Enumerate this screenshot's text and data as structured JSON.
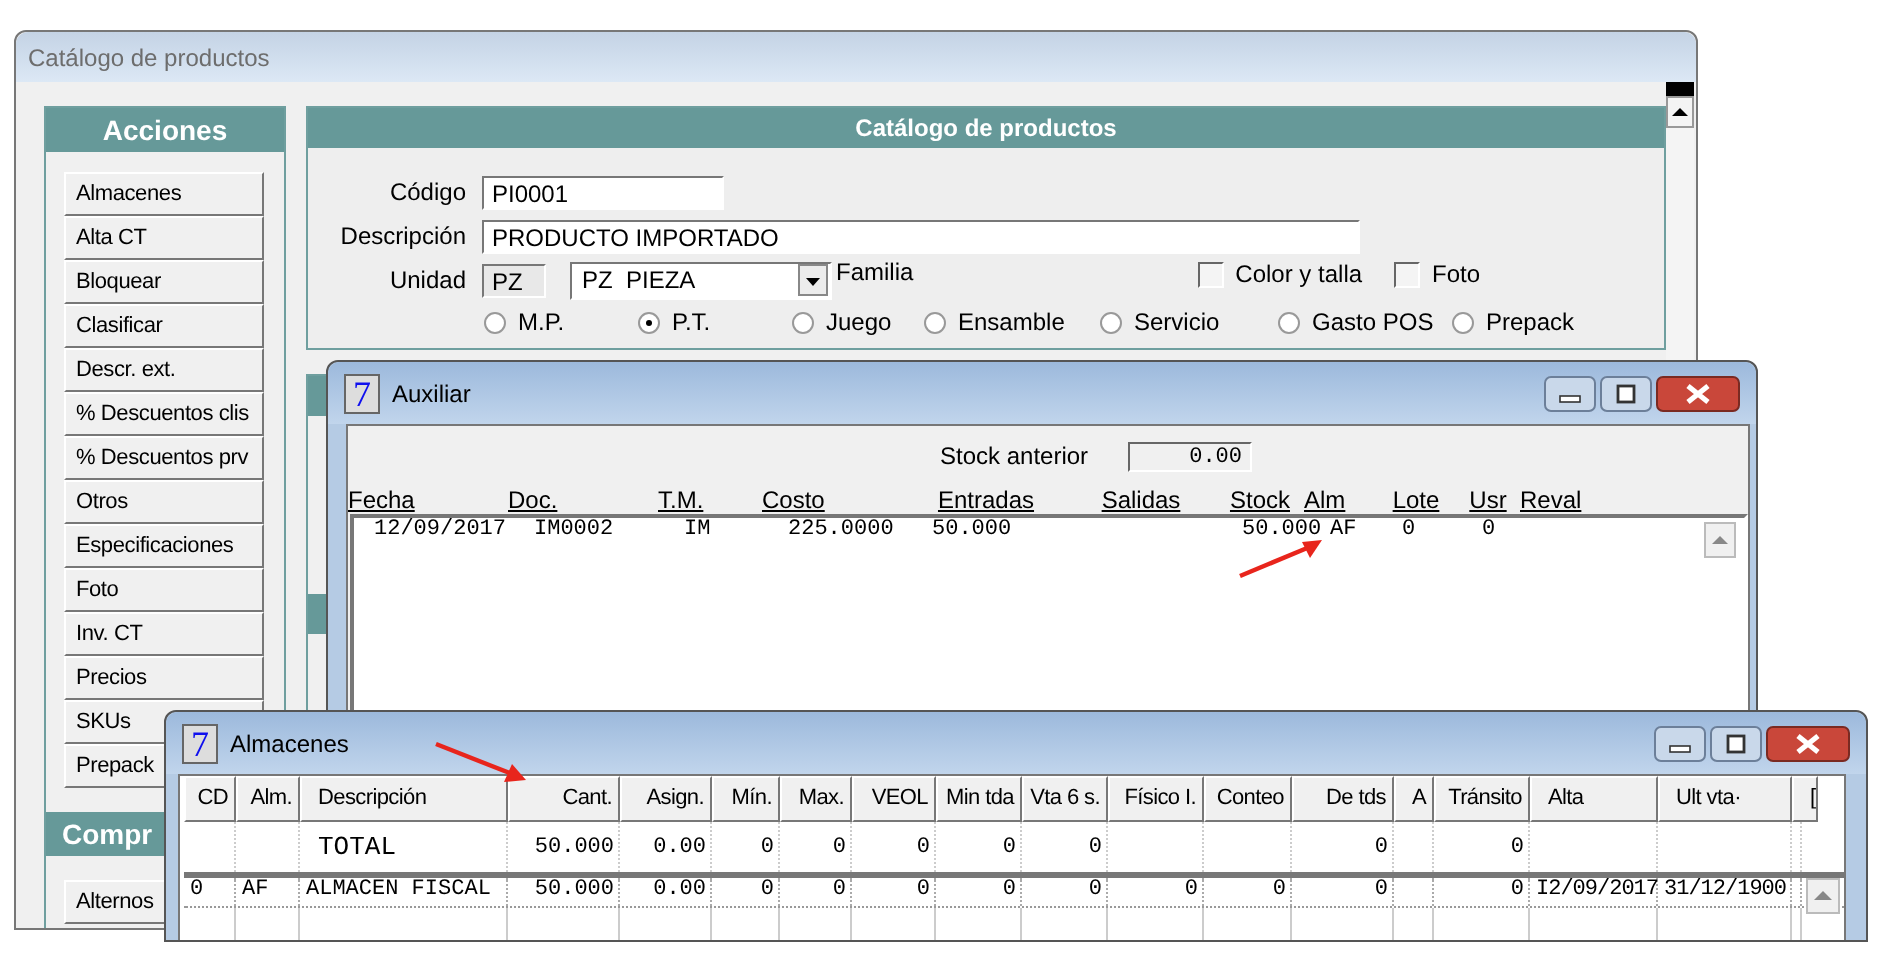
{
  "main_window": {
    "title": "Catálogo de productos"
  },
  "sidebar": {
    "title": "Acciones",
    "items": [
      {
        "label": "Almacenes"
      },
      {
        "label": "Alta CT"
      },
      {
        "label": "Bloquear"
      },
      {
        "label": "Clasificar"
      },
      {
        "label": "Descr. ext."
      },
      {
        "label": "% Descuentos clis"
      },
      {
        "label": "% Descuentos prv"
      },
      {
        "label": "Otros"
      },
      {
        "label": "Especificaciones"
      },
      {
        "label": "Foto"
      },
      {
        "label": "Inv. CT"
      },
      {
        "label": "Precios"
      },
      {
        "label": "SKUs"
      },
      {
        "label": "Prepack"
      }
    ],
    "section_2_title": "Compr",
    "section_2_items": [
      {
        "label": "Alternos"
      }
    ]
  },
  "product_panel": {
    "title": "Catálogo de productos",
    "codigo_label": "Código",
    "codigo": "PI0001",
    "descripcion_label": "Descripción",
    "descripcion": "PRODUCTO IMPORTADO",
    "unidad_label": "Unidad",
    "unidad_code": "PZ",
    "unidad": "PZ  PIEZA",
    "familia_label": "Familia",
    "checkboxes": [
      {
        "label": "Color y talla",
        "checked": false
      },
      {
        "label": "Foto",
        "checked": false
      }
    ],
    "types": [
      {
        "label": "M.P.",
        "selected": false
      },
      {
        "label": "P.T.",
        "selected": true
      },
      {
        "label": "Juego",
        "selected": false
      },
      {
        "label": "Ensamble",
        "selected": false
      },
      {
        "label": "Servicio",
        "selected": false
      },
      {
        "label": "Gasto POS",
        "selected": false
      },
      {
        "label": "Prepack",
        "selected": false
      }
    ]
  },
  "auxiliar_window": {
    "app_icon": "7",
    "title": "Auxiliar",
    "stock_anterior_label": "Stock anterior",
    "stock_anterior": "0.00",
    "columns": [
      "Fecha",
      "Doc.",
      "T.M.",
      "Costo",
      "Entradas",
      "Salidas",
      "Stock",
      "Alm",
      "Lote",
      "Usr",
      "Reval"
    ],
    "rows": [
      {
        "fecha": "12/09/2017",
        "doc": "IM0002",
        "tm": "IM",
        "costo": "225.0000",
        "entradas": "50.000",
        "stock": "50.000",
        "alm": "AF",
        "lote": "0",
        "usr": "0"
      }
    ]
  },
  "almacenes_window": {
    "app_icon": "7",
    "title": "Almacenes",
    "columns": [
      "CD",
      "Alm.",
      "Descripción",
      "Cant.",
      "Asign.",
      "Mín.",
      "Max.",
      "VEOL",
      "Min tda",
      "Vta 6 s.",
      "Físico I.",
      "Conteo",
      "De tds",
      "A",
      "Tránsito",
      "Alta",
      "Ult vta·",
      "["
    ],
    "total_row": {
      "descripcion": "TOTAL",
      "cant": "50.000",
      "asign": "0.00",
      "min": "0",
      "max": "0",
      "veol": "0",
      "min_tda": "0",
      "vta_6s": "0",
      "de_tds": "0",
      "transito": "0"
    },
    "rows": [
      {
        "cd": "0",
        "alm": "AF",
        "descripcion": "ALMACEN FISCAL",
        "cant": "50.000",
        "asign": "0.00",
        "min": "0",
        "max": "0",
        "veol": "0",
        "min_tda": "0",
        "vta_6s": "0",
        "fisico_i": "0",
        "conteo": "0",
        "de_tds": "0",
        "transito": "0",
        "alta": "I2/09/2017",
        "ult_vta": "31/12/1900"
      }
    ]
  }
}
